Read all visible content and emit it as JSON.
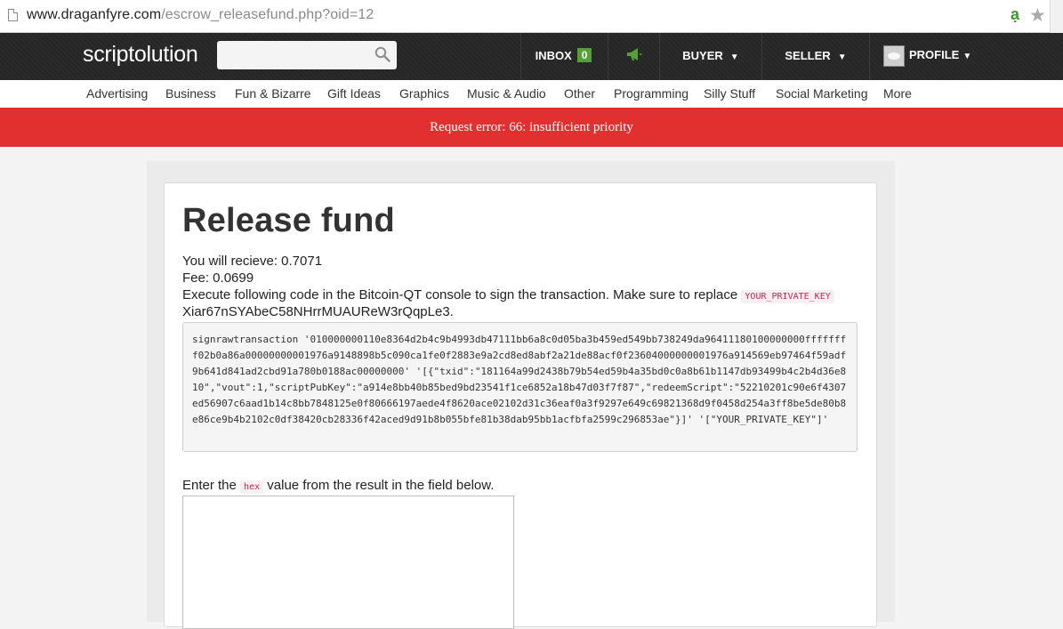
{
  "browser": {
    "url_domain": "www.draganfyre.com",
    "url_path": "/escrow_releasefund.php?oid=12"
  },
  "nav": {
    "logo": "scriptolution",
    "search": {
      "placeholder": ""
    },
    "inbox_label": "INBOX",
    "inbox_count": "0",
    "buyer_label": "BUYER",
    "seller_label": "SELLER",
    "profile_label": "PROFILE",
    "caret": "▼",
    "icons": [
      "search-icon",
      "megaphone-icon",
      "avatar"
    ]
  },
  "categories": [
    "Advertising",
    "Business",
    "Fun & Bizarre",
    "Gift Ideas",
    "Graphics",
    "Music & Audio",
    "Other",
    "Programming",
    "Silly Stuff",
    "Social Marketing",
    "More"
  ],
  "error": {
    "message": "Request error: 66: insufficient priority"
  },
  "main": {
    "title": "Release fund",
    "receive": "You will recieve: 0.7071",
    "fee": "Fee: 0.0699",
    "instruction": "Execute following code in the Bitcoin-QT console to sign the transaction. Make sure to replace",
    "private_key_placeholder": "YOUR_PRIVATE_KEY",
    "address": "Xiar67nSYAbeC58NHrrMUAUReW3rQqpLe3.",
    "code": "signrawtransaction '010000000110e8364d2b4c9b4993db47111bb6a8c0d05ba3b459ed549bb738249da96411180100000000ffffffff02b0a86a00000000001976a9148898b5c090ca1fe0f2883e9a2cd8ed8abf2a21de88acf0f23604000000001976a914569eb97464f59adf9b641d841ad2cbd91a780b0188ac00000000' '[{\"txid\":\"181164a99d2438b79b54ed59b4a35bd0c0a8b61b1147db93499b4c2b4d36e810\",\"vout\":1,\"scriptPubKey\":\"a914e8bb40b85bed9bd23541f1ce6852a18b47d03f7f87\",\"redeemScript\":\"52210201c90e6f4307ed56907c6aad1b14c8bb7848125e0f80666197aede4f8620ace02102d31c36eaf0a3f9297e649c69821368d9f0458d254a3ff8be5de80b8e86ce9b4b2102c0df38420cb28336f42aced9d91b8b055bfe81b38dab95bb1acfbfa2599c296853ae\"}]' '[\"YOUR_PRIVATE_KEY\"]'",
    "hex_prefix": "Enter the",
    "hex_code": "hex",
    "hex_suffix": "value from the result in the field below.",
    "hex_value": ""
  },
  "colors": {
    "nav_bg": "#262626",
    "error_bg": "#e1302f",
    "badge_green": "#57a034",
    "code_pink": "#c7254e"
  }
}
